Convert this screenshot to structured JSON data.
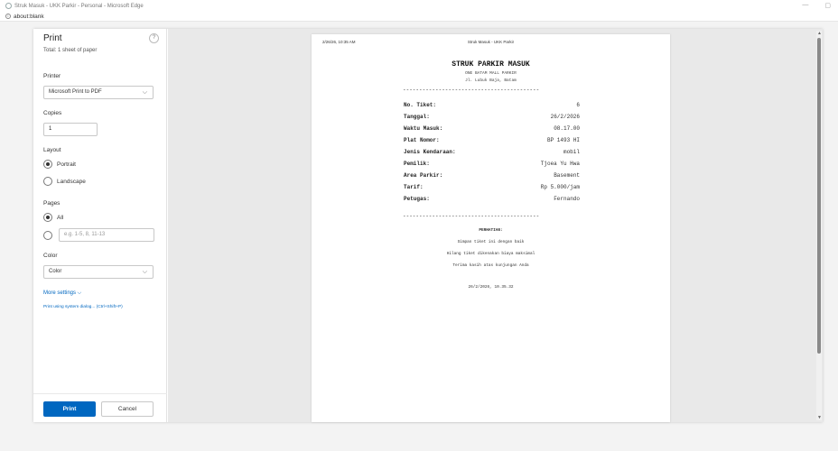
{
  "window": {
    "title": "Struk Masuk - UKK Parkir - Personal - Microsoft Edge",
    "url": "about:blank",
    "minimize": "—",
    "restore": "▢"
  },
  "print_panel": {
    "title": "Print",
    "subtitle": "Total: 1 sheet of paper",
    "help": "?",
    "printer_label": "Printer",
    "printer_value": "Microsoft Print to PDF",
    "copies_label": "Copies",
    "copies_value": "1",
    "layout_label": "Layout",
    "layout_options": [
      "Portrait",
      "Landscape"
    ],
    "pages_label": "Pages",
    "pages_all": "All",
    "pages_placeholder": "e.g. 1-5, 8, 11-13",
    "color_label": "Color",
    "color_value": "Color",
    "more_settings": "More settings ⌵",
    "system_dialog": "Print using system dialog... (Ctrl+Shift+P)",
    "print_button": "Print",
    "cancel_button": "Cancel"
  },
  "paper": {
    "header_left": "2/26/26, 10:35 AM",
    "header_center": "Struk Masuk - UKK Parkir",
    "receipt_title": "STRUK PARKIR MASUK",
    "receipt_place": "ONE BATAM MALL PARKIR",
    "receipt_address": "Jl. Lubuk Baja, Batam",
    "divider": "------------------------------------------",
    "rows": [
      {
        "key": "No. Tiket:",
        "value": "6"
      },
      {
        "key": "Tanggal:",
        "value": "26/2/2026"
      },
      {
        "key": "Waktu Masuk:",
        "value": "08.17.00"
      },
      {
        "key": "Plat Nomor:",
        "value": "BP 1493 HI"
      },
      {
        "key": "Jenis Kendaraan:",
        "value": "mobil"
      },
      {
        "key": "Pemilik:",
        "value": "Tjoea Yu Hwa"
      },
      {
        "key": "Area Parkir:",
        "value": "Basement"
      },
      {
        "key": "Tarif:",
        "value": "Rp 5.000/jam"
      },
      {
        "key": "Petugas:",
        "value": "Fernando"
      }
    ],
    "notice_title": "PERHATIAN:",
    "notice_lines": [
      "Simpan tiket ini dengan baik",
      "Hilang tiket dikenakan biaya maksimal",
      "Terima kasih atas kunjungan Anda"
    ],
    "printed_at": "26/2/2026, 10.35.32"
  }
}
